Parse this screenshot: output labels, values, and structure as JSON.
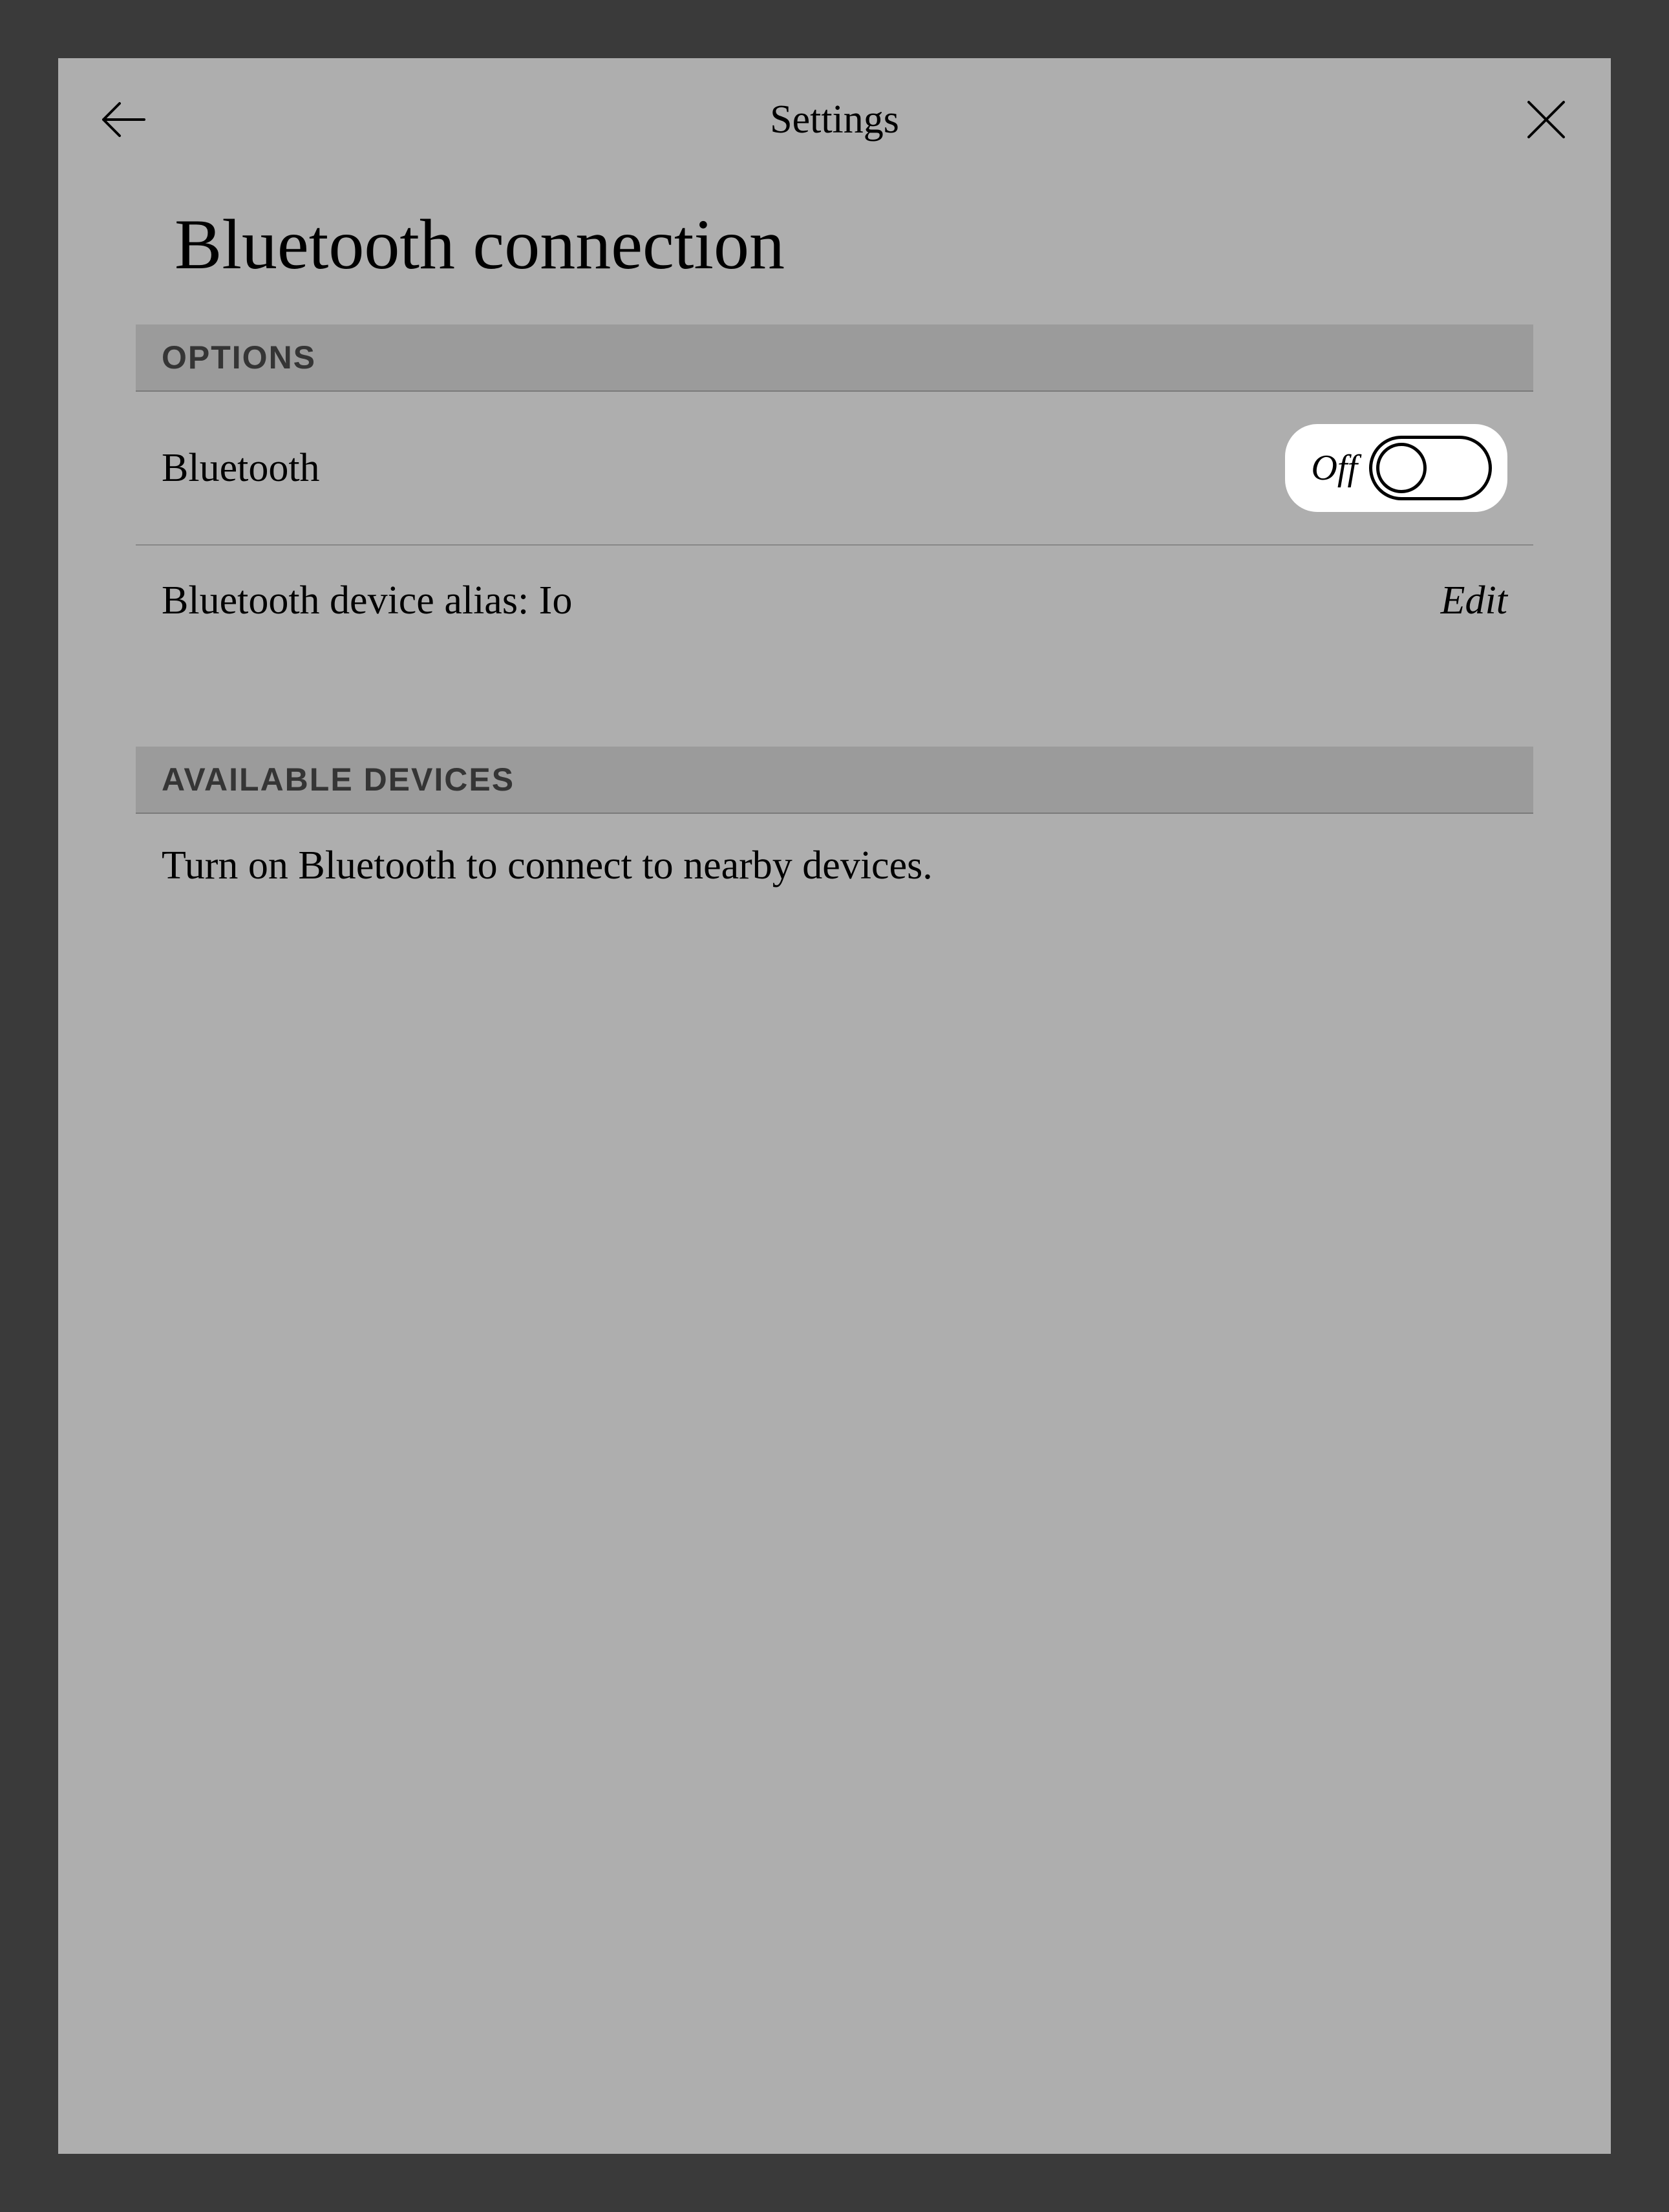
{
  "header": {
    "title": "Settings"
  },
  "page": {
    "title": "Bluetooth connection"
  },
  "sections": {
    "options": {
      "header": "OPTIONS",
      "bluetooth_label": "Bluetooth",
      "toggle_state": "Off",
      "alias_label": "Bluetooth device alias: Io",
      "edit_label": "Edit"
    },
    "available_devices": {
      "header": "AVAILABLE DEVICES",
      "info_text": "Turn on Bluetooth to connect to nearby devices."
    }
  }
}
